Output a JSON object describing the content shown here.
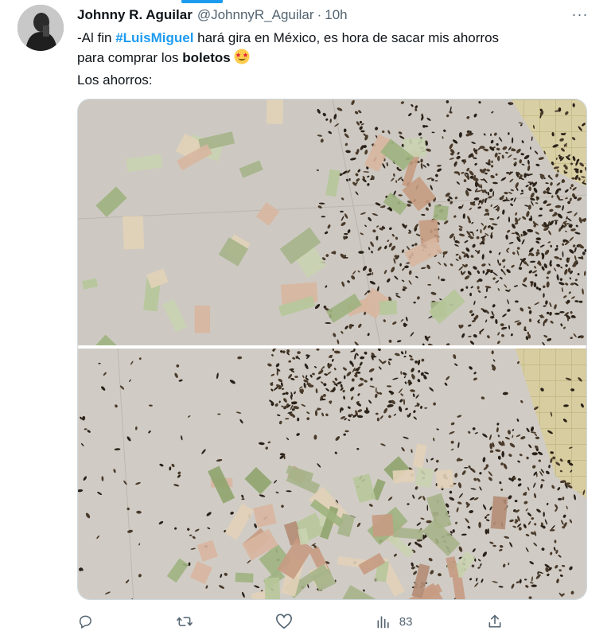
{
  "author": {
    "display_name": "Johnny R. Aguilar",
    "handle": "@JohnnyR_Aguilar",
    "separator": "·",
    "time": "10h",
    "avatar_icon": "user-avatar"
  },
  "more_label": "···",
  "tweet_text": {
    "line1_prefix": "-Al fin ",
    "hashtag": "#LuisMiguel",
    "line1_suffix": " hará gira en México, es hora de sacar mis ahorros",
    "line2_prefix": "para comprar los ",
    "line2_bold": "boletos",
    "emoji": "star-struck-emoji",
    "line3": "Los ahorros:"
  },
  "media": {
    "photos": [
      "photo-1",
      "photo-2"
    ]
  },
  "actions": {
    "reply": {
      "icon": "reply-icon",
      "count": ""
    },
    "retweet": {
      "icon": "retweet-icon",
      "count": ""
    },
    "like": {
      "icon": "heart-icon",
      "count": ""
    },
    "views": {
      "icon": "analytics-icon",
      "count": "83"
    },
    "share": {
      "icon": "share-icon",
      "count": ""
    }
  },
  "colors": {
    "accent": "#1d9bf0",
    "text": "#0f1419",
    "secondary": "#536471"
  }
}
